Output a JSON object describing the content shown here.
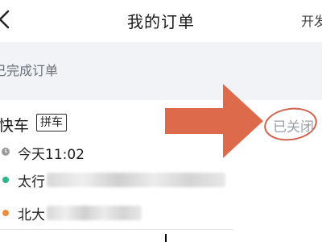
{
  "header": {
    "title": "我的订单",
    "invoice_label": "开发票"
  },
  "section": {
    "label": "已完成订单"
  },
  "order": {
    "service": "快车",
    "tag": "拼车",
    "status": "已关闭",
    "time": "今天11:02",
    "origin": "太行",
    "destination": "北大"
  },
  "colors": {
    "annotation_arrow": "#dd6a4a",
    "annotation_circle": "#d2604a",
    "start_dot": "#2bb58a",
    "end_dot": "#f08a3c"
  },
  "icons": {
    "back": "back-chevron-icon",
    "clock": "clock-icon"
  }
}
